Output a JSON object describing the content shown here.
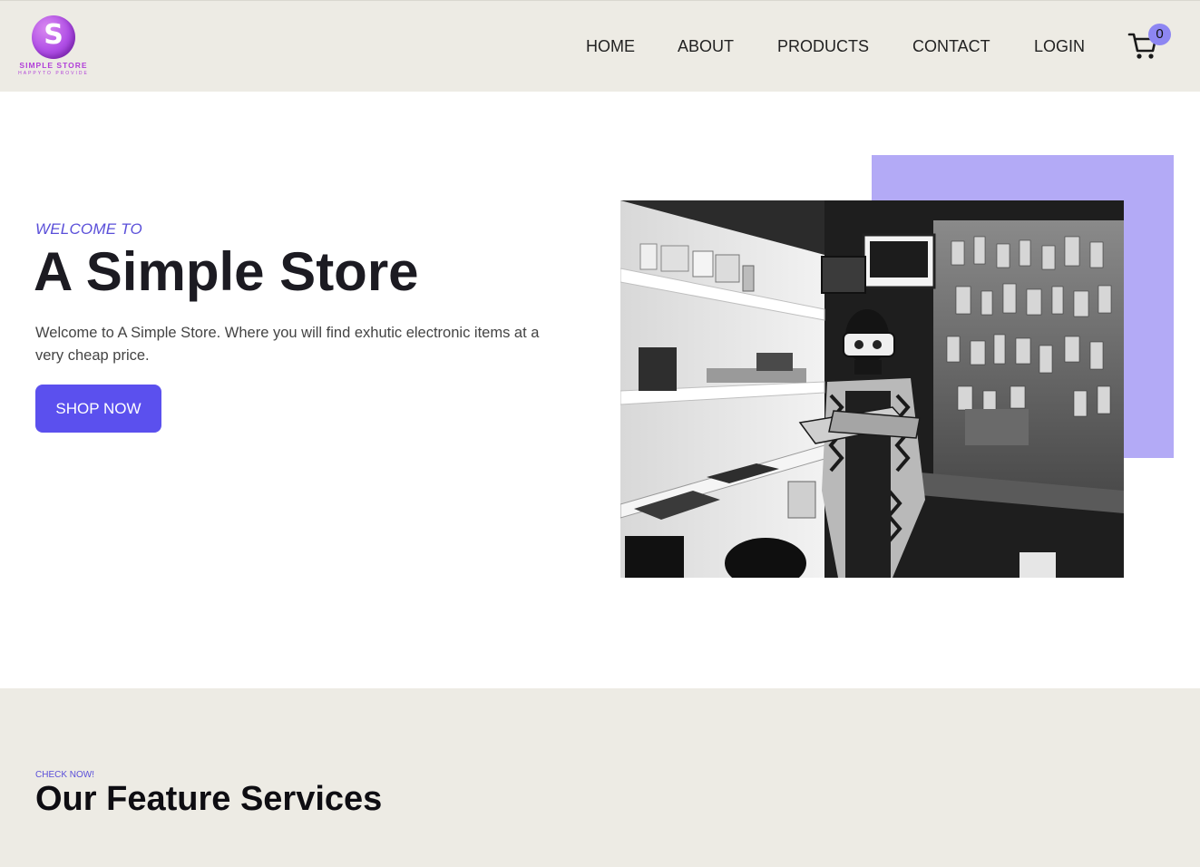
{
  "brand": {
    "logo_letter": "S",
    "name": "SIMPLE STORE",
    "tagline": "HAPPYTO PROVIDE"
  },
  "nav": {
    "items": [
      {
        "label": "HOME"
      },
      {
        "label": "ABOUT"
      },
      {
        "label": "PRODUCTS"
      },
      {
        "label": "CONTACT"
      },
      {
        "label": "LOGIN"
      }
    ],
    "cart_icon": "cart-icon",
    "cart_count": "0"
  },
  "hero": {
    "eyebrow": "WELCOME TO",
    "title": "A Simple Store",
    "description": "Welcome to A Simple Store. Where you will find exhutic electronic items at a very cheap price.",
    "cta_label": "SHOP NOW",
    "image_alt": "Man wearing a VR headset in an electronics shop (black and white photo)"
  },
  "features": {
    "eyebrow": "CHECK NOW!",
    "title": "Our Feature Services"
  },
  "colors": {
    "accent": "#5b50ee",
    "accent_light": "#b3aaf6",
    "header_bg": "#edebe4",
    "brand_purple": "#b13fd9"
  }
}
